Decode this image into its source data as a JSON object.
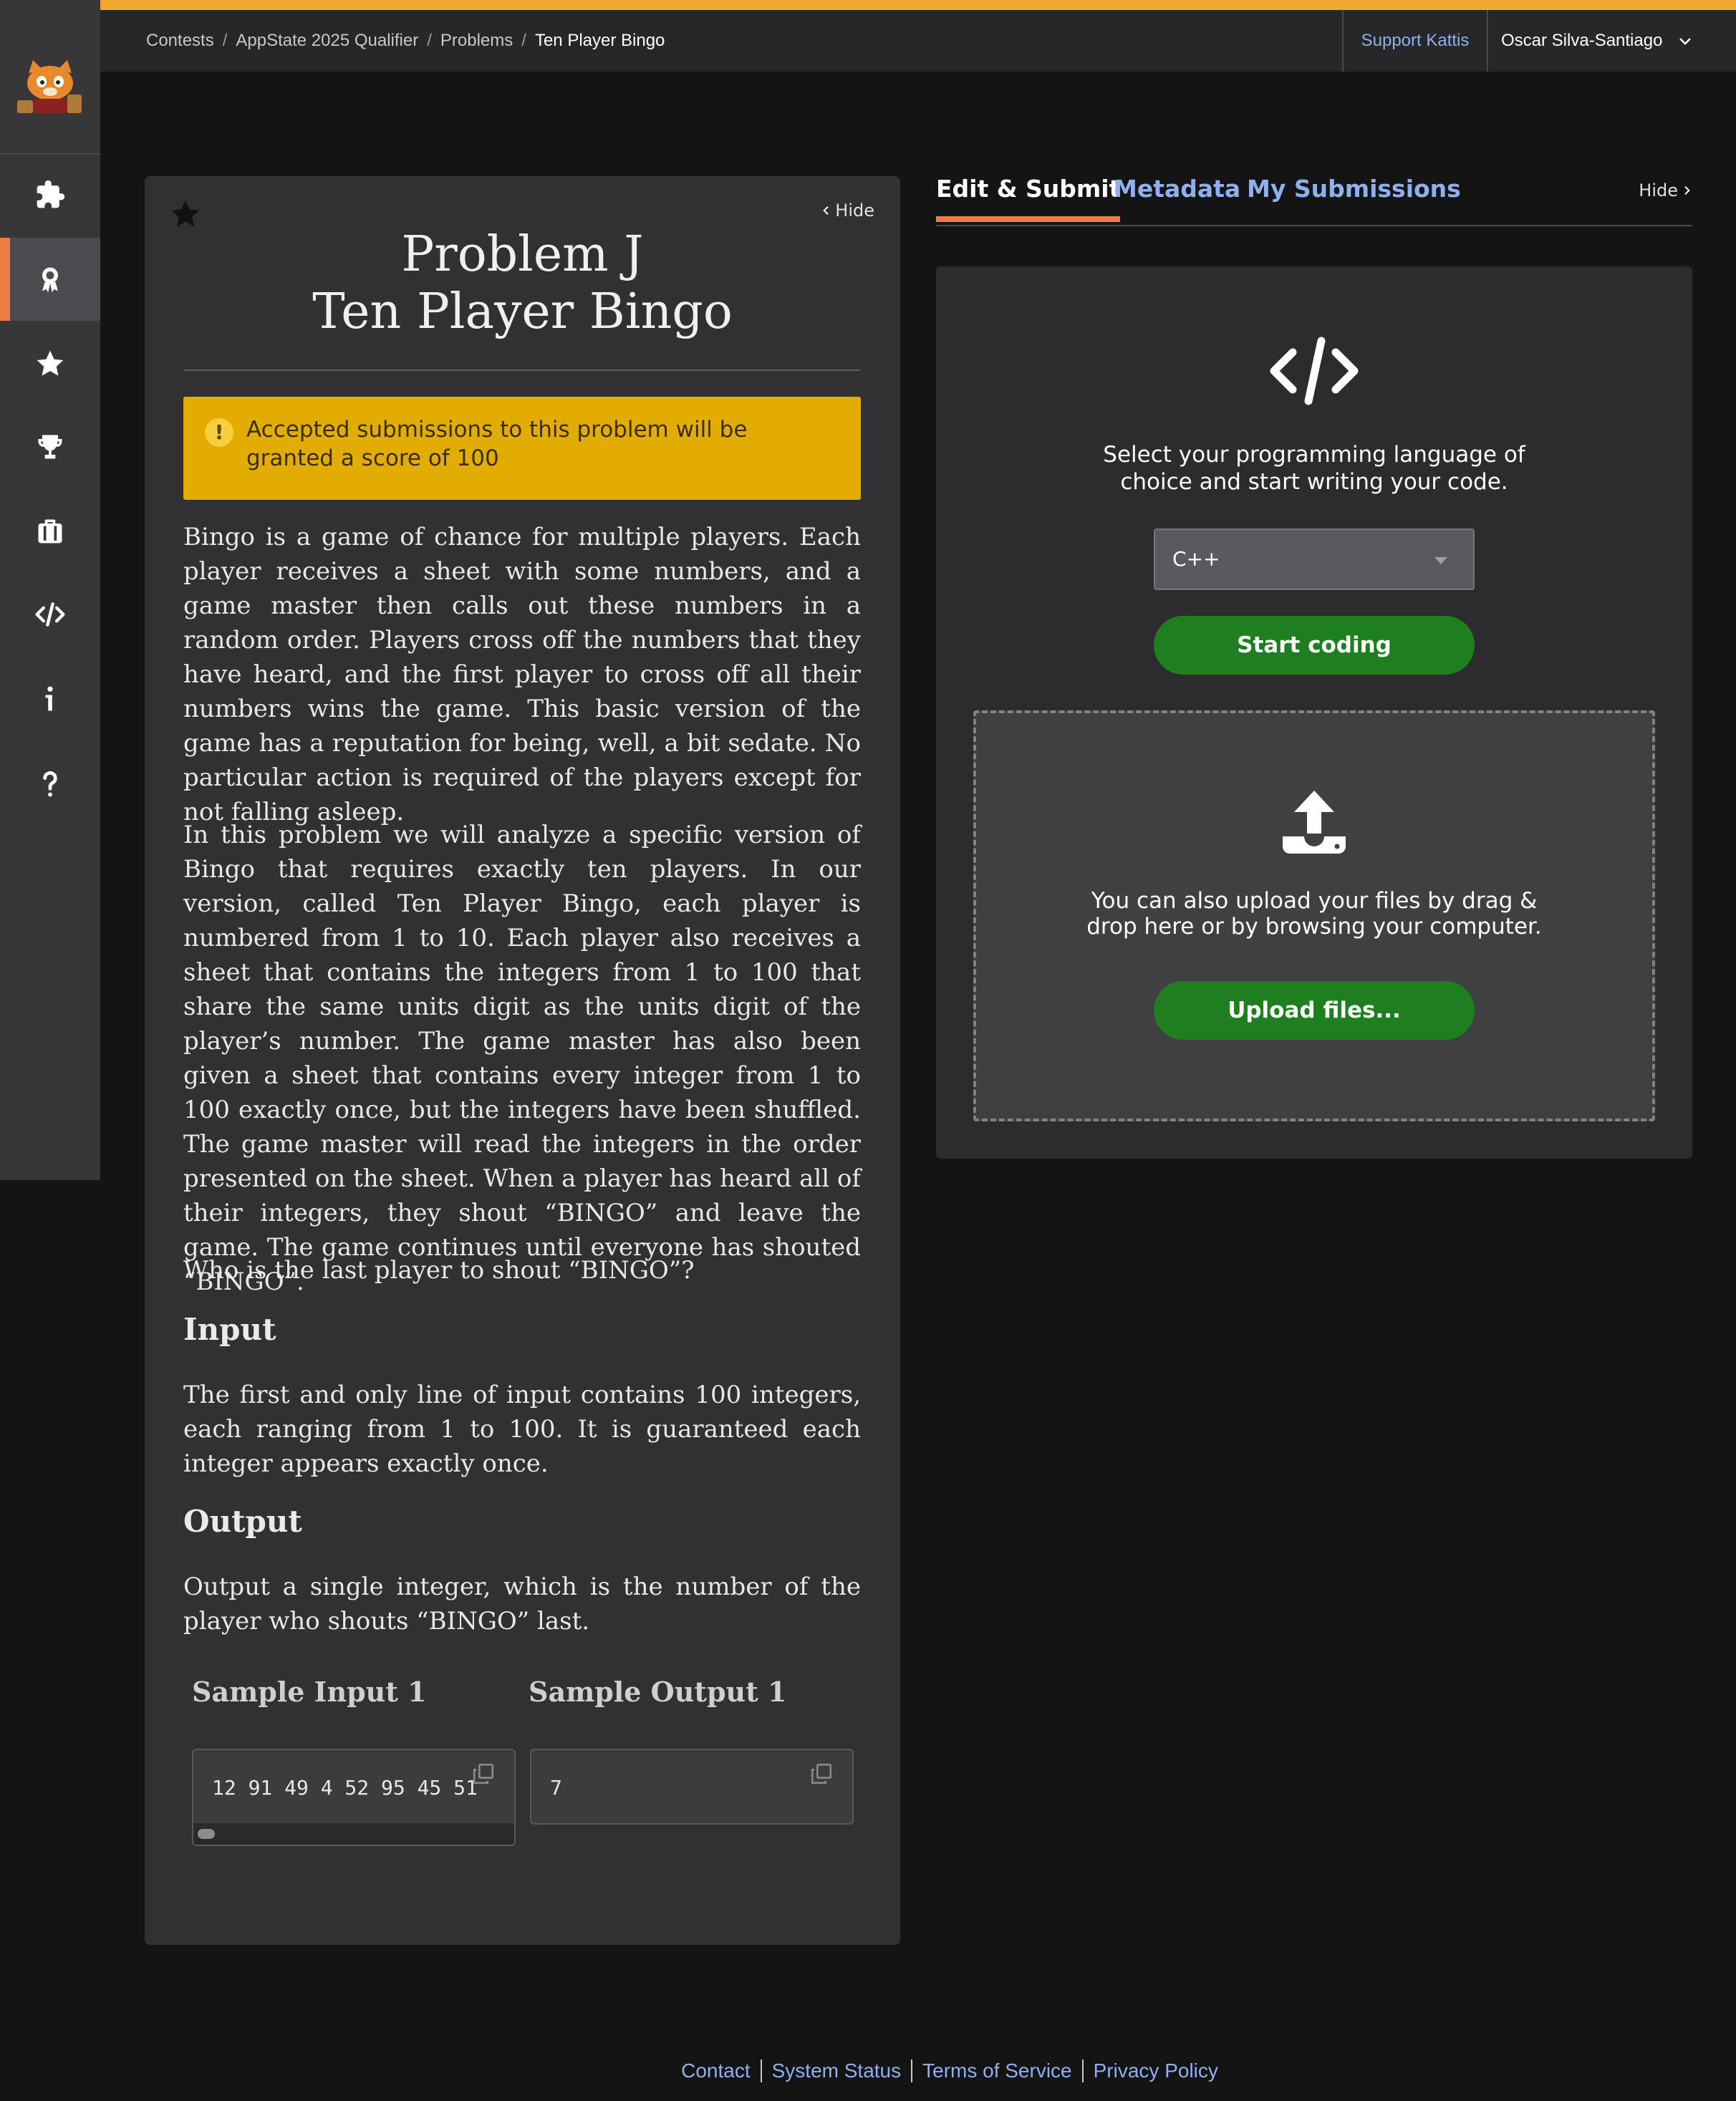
{
  "breadcrumb": [
    "Contests",
    "AppState 2025 Qualifier",
    "Problems",
    "Ten Player Bingo"
  ],
  "header": {
    "support_label": "Support Kattis",
    "user_name": "Oscar Silva-Santiago"
  },
  "sidebar": {
    "items": [
      {
        "icon": "puzzle-icon",
        "active": false
      },
      {
        "icon": "award-icon",
        "active": true
      },
      {
        "icon": "star-icon",
        "active": false
      },
      {
        "icon": "trophy-icon",
        "active": false
      },
      {
        "icon": "briefcase-icon",
        "active": false
      },
      {
        "icon": "code-icon",
        "active": false
      },
      {
        "icon": "info-icon",
        "active": false
      },
      {
        "icon": "help-icon",
        "active": false
      }
    ]
  },
  "problem": {
    "hide_label": "Hide",
    "title_line1": "Problem J",
    "title_line2": "Ten Player Bingo",
    "notice": "Accepted submissions to this problem will be granted a score of 100",
    "paragraphs": [
      "Bingo is a game of chance for multiple players. Each player receives a sheet with some numbers, and a game master then calls out these numbers in a random order. Players cross off the numbers that they have heard, and the first player to cross off all their numbers wins the game. This basic version of the game has a reputation for being, well, a bit sedate. No particular action is required of the players except for not falling asleep.",
      "In this problem we will analyze a specific version of Bingo that requires exactly ten players. In our version, called Ten Player Bingo, each player is numbered from 1 to 10. Each player also receives a sheet that contains the integers from 1 to 100 that share the same units digit as the units digit of the player’s number. The game master has also been given a sheet that contains every integer from 1 to 100 exactly once, but the integers have been shuffled. The game master will read the integers in the order presented on the sheet. When a player has heard all of their integers, they shout “BINGO” and leave the game. The game continues until everyone has shouted “BINGO”.",
      "Who is the last player to shout “BINGO”?"
    ],
    "input_heading": "Input",
    "input_text": "The first and only line of input contains 100 integers, each ranging from 1 to 100. It is guaranteed each integer appears exactly once.",
    "output_heading": "Output",
    "output_text": "Output a single integer, which is the number of the player who shouts “BINGO” last.",
    "sample_input_heading": "Sample Input 1",
    "sample_output_heading": "Sample Output 1",
    "sample_input": "12 91 49 4 52 95 45 51",
    "sample_output": "7"
  },
  "tabs": [
    {
      "label": "Edit & Submit",
      "active": true
    },
    {
      "label": "Metadata",
      "active": false
    },
    {
      "label": "My Submissions",
      "active": false
    }
  ],
  "right_hide_label": "Hide",
  "editor": {
    "message_line1": "Select your programming language of",
    "message_line2": "choice and start writing your code.",
    "language": "C++",
    "start_button": "Start coding",
    "upload_line1": "You can also upload your files by drag &",
    "upload_line2": "drop here or by browsing your computer.",
    "upload_button": "Upload files..."
  },
  "footer": {
    "links": [
      "Contact",
      "System Status",
      "Terms of Service",
      "Privacy Policy"
    ]
  },
  "colors": {
    "accent": "#f07b45",
    "notice": "#e3ad00",
    "button_green": "#1e7f1e",
    "link": "#8fb0f0",
    "top_stripe": "#f0a830"
  }
}
